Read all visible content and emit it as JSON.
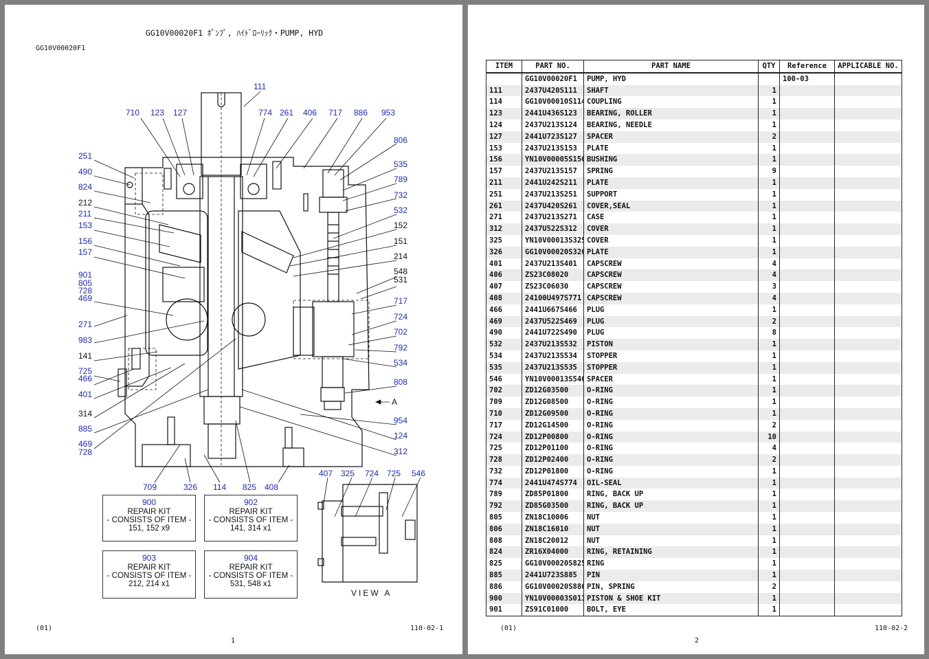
{
  "page1": {
    "title": "GG10V00020F1 ﾎﾟﾝﾌﾟ, ﾊｲﾄﾞﾛｰﾘｯｸ・PUMP, HYD",
    "code": "GG10V00020F1",
    "rev": "(01)",
    "ref": "110-02-1",
    "page_no": "1",
    "view_label": "VIEW A",
    "arrow_label": "A",
    "callouts": {
      "c111": "111",
      "c710": "710",
      "c123": "123",
      "c127": "127",
      "c774": "774",
      "c261": "261",
      "c406": "406",
      "c717a": "717",
      "c886": "886",
      "c953": "953",
      "c806": "806",
      "c251": "251",
      "c490": "490",
      "c824": "824",
      "c535": "535",
      "c789": "789",
      "c732": "732",
      "c212": "212",
      "c211": "211",
      "c532": "532",
      "c153": "153",
      "c152": "152",
      "c156": "156",
      "c151": "151",
      "c157": "157",
      "c214": "214",
      "c548": "548",
      "c531": "531",
      "c901": "901",
      "c805": "805",
      "c728a": "728",
      "c469a": "469",
      "c717b": "717",
      "c271": "271",
      "c724a": "724",
      "c983": "983",
      "c702": "702",
      "c141": "141",
      "c792": "792",
      "c534": "534",
      "c725a": "725",
      "c466": "466",
      "c808": "808",
      "c401": "401",
      "c314": "314",
      "c954": "954",
      "c885": "885",
      "c124": "124",
      "c469b": "469",
      "c728b": "728",
      "c312": "312",
      "c709": "709",
      "c326": "326",
      "c114": "114",
      "c825": "825",
      "c408": "408",
      "c407": "407",
      "c325": "325",
      "c724b": "724",
      "c725b": "725",
      "c546": "546"
    },
    "kits": [
      {
        "num": "900",
        "title": "REPAIR KIT",
        "consists": "- CONSISTS OF ITEM -",
        "items": "151, 152 x9"
      },
      {
        "num": "902",
        "title": "REPAIR KIT",
        "consists": "- CONSISTS OF ITEM -",
        "items": "141, 314 x1"
      },
      {
        "num": "903",
        "title": "REPAIR KIT",
        "consists": "- CONSISTS OF ITEM -",
        "items": "212, 214 x1"
      },
      {
        "num": "904",
        "title": "REPAIR KIT",
        "consists": "- CONSISTS OF ITEM -",
        "items": "531, 548 x1"
      }
    ]
  },
  "page2": {
    "rev": "(01)",
    "ref": "110-02-2",
    "page_no": "2",
    "headers": [
      "ITEM",
      "PART NO.",
      "PART NAME",
      "QTY",
      "Reference",
      "APPLICABLE NO."
    ],
    "rows": [
      [
        "",
        "GG10V00020F1",
        "PUMP, HYD",
        "",
        "100-03",
        ""
      ],
      [
        "111",
        "2437U420S111",
        "SHAFT",
        "1",
        "",
        ""
      ],
      [
        "114",
        "GG10V00010S114",
        "COUPLING",
        "1",
        "",
        ""
      ],
      [
        "123",
        "2441U436S123",
        "BEARING, ROLLER",
        "1",
        "",
        ""
      ],
      [
        "124",
        "2437U213S124",
        "BEARING, NEEDLE",
        "1",
        "",
        ""
      ],
      [
        "127",
        "2441U723S127",
        "SPACER",
        "2",
        "",
        ""
      ],
      [
        "153",
        "2437U213S153",
        "PLATE",
        "1",
        "",
        ""
      ],
      [
        "156",
        "YN10V00005S156",
        "BUSHING",
        "1",
        "",
        ""
      ],
      [
        "157",
        "2437U213S157",
        "SPRING",
        "9",
        "",
        ""
      ],
      [
        "211",
        "2441U242S211",
        "PLATE",
        "1",
        "",
        ""
      ],
      [
        "251",
        "2437U213S251",
        "SUPPORT",
        "1",
        "",
        ""
      ],
      [
        "261",
        "2437U420S261",
        "COVER,SEAL",
        "1",
        "",
        ""
      ],
      [
        "271",
        "2437U213S271",
        "CASE",
        "1",
        "",
        ""
      ],
      [
        "312",
        "2437U522S312",
        "COVER",
        "1",
        "",
        ""
      ],
      [
        "325",
        "YN10V00013S325",
        "COVER",
        "1",
        "",
        ""
      ],
      [
        "326",
        "GG10V00020S326",
        "PLATE",
        "1",
        "",
        ""
      ],
      [
        "401",
        "2437U213S401",
        "CAPSCREW",
        "4",
        "",
        ""
      ],
      [
        "406",
        "ZS23C08020",
        "CAPSCREW",
        "4",
        "",
        ""
      ],
      [
        "407",
        "ZS23C06030",
        "CAPSCREW",
        "3",
        "",
        ""
      ],
      [
        "408",
        "24100U497S771",
        "CAPSCREW",
        "4",
        "",
        ""
      ],
      [
        "466",
        "2441U667S466",
        "PLUG",
        "1",
        "",
        ""
      ],
      [
        "469",
        "2437U522S469",
        "PLUG",
        "2",
        "",
        ""
      ],
      [
        "490",
        "2441U722S490",
        "PLUG",
        "8",
        "",
        ""
      ],
      [
        "532",
        "2437U213S532",
        "PISTON",
        "1",
        "",
        ""
      ],
      [
        "534",
        "2437U213S534",
        "STOPPER",
        "1",
        "",
        ""
      ],
      [
        "535",
        "2437U213S535",
        "STOPPER",
        "1",
        "",
        ""
      ],
      [
        "546",
        "YN10V00013S546",
        "SPACER",
        "1",
        "",
        ""
      ],
      [
        "702",
        "ZD12G03500",
        "O-RING",
        "1",
        "",
        ""
      ],
      [
        "709",
        "ZD12G08500",
        "O-RING",
        "1",
        "",
        ""
      ],
      [
        "710",
        "ZD12G09500",
        "O-RING",
        "1",
        "",
        ""
      ],
      [
        "717",
        "ZD12G14500",
        "O-RING",
        "2",
        "",
        ""
      ],
      [
        "724",
        "ZD12P00800",
        "O-RING",
        "10",
        "",
        ""
      ],
      [
        "725",
        "ZD12P01100",
        "O-RING",
        "4",
        "",
        ""
      ],
      [
        "728",
        "ZD12P02400",
        "O-RING",
        "2",
        "",
        ""
      ],
      [
        "732",
        "ZD12P01800",
        "O-RING",
        "1",
        "",
        ""
      ],
      [
        "774",
        "2441U474S774",
        "OIL-SEAL",
        "1",
        "",
        ""
      ],
      [
        "789",
        "ZD85P01800",
        "RING, BACK UP",
        "1",
        "",
        ""
      ],
      [
        "792",
        "ZD85G03500",
        "RING, BACK UP",
        "1",
        "",
        ""
      ],
      [
        "805",
        "ZN18C10006",
        "NUT",
        "1",
        "",
        ""
      ],
      [
        "806",
        "ZN18C16010",
        "NUT",
        "1",
        "",
        ""
      ],
      [
        "808",
        "ZN18C20012",
        "NUT",
        "1",
        "",
        ""
      ],
      [
        "824",
        "ZR16X04000",
        "RING, RETAINING",
        "1",
        "",
        ""
      ],
      [
        "825",
        "GG10V00020S825",
        "RING",
        "1",
        "",
        ""
      ],
      [
        "885",
        "2441U723S885",
        "PIN",
        "1",
        "",
        ""
      ],
      [
        "886",
        "GG10V00020S886",
        "PIN, SPRING",
        "2",
        "",
        ""
      ],
      [
        "900",
        "YN10V00003S011",
        "PISTON & SHOE KIT",
        "1",
        "",
        ""
      ],
      [
        "901",
        "ZS91C01000",
        "BOLT, EYE",
        "1",
        "",
        ""
      ]
    ]
  }
}
